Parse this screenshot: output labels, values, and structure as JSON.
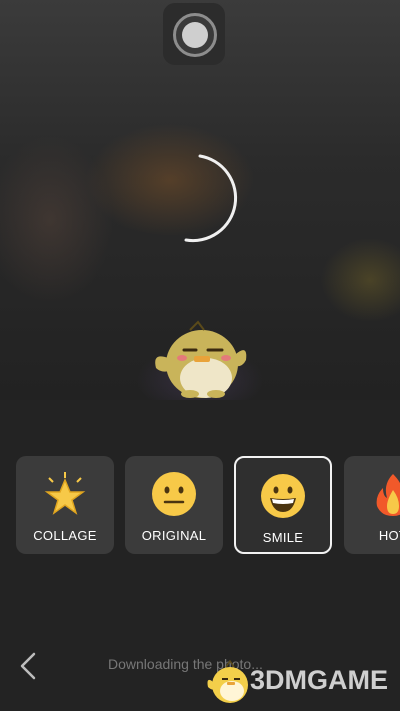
{
  "camera": {
    "shutter_icon": "shutter-icon",
    "spinner_icon": "loading-spinner-icon",
    "mascot_icon": "chick-mascot-icon"
  },
  "filters": [
    {
      "label": "COLLAGE",
      "icon": "glowing-star-icon",
      "selected": false
    },
    {
      "label": "ORIGINAL",
      "icon": "neutral-face-icon",
      "selected": false
    },
    {
      "label": "SMILE",
      "icon": "grinning-face-icon",
      "selected": true
    },
    {
      "label": "HOT",
      "icon": "fire-icon",
      "selected": false
    }
  ],
  "footer": {
    "back_icon": "chevron-left-icon",
    "status": "Downloading the photo...",
    "watermark": "3DMGAME"
  },
  "colors": {
    "background": "#232323",
    "tile": "#3b3b3b",
    "selected_border": "#f2f2f2",
    "emoji_yellow": "#f7c948"
  }
}
